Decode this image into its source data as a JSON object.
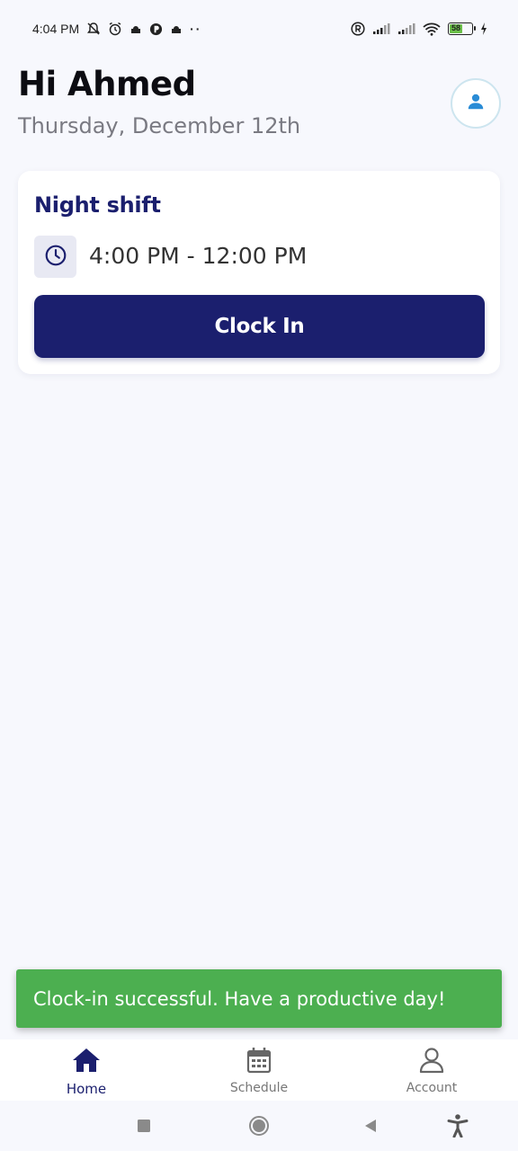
{
  "status_bar": {
    "time": "4:04 PM",
    "battery_level": "58",
    "icons": [
      "bell-off-icon",
      "alarm-icon",
      "mosque-icon",
      "app-icon",
      "mosque-icon",
      "more-dots-icon",
      "registered-icon",
      "signal-icon",
      "signal-icon",
      "wifi-icon",
      "battery-icon",
      "charging-icon"
    ],
    "more_dots": "··"
  },
  "header": {
    "greeting": "Hi Ahmed",
    "date": "Thursday, December 12th",
    "avatar_icon": "person-icon"
  },
  "shift_card": {
    "title": "Night shift",
    "clock_icon": "clock-icon",
    "time_range": "4:00 PM - 12:00 PM",
    "button_label": "Clock In"
  },
  "snackbar": {
    "message": "Clock-in successful. Have a productive day!"
  },
  "bottom_nav": {
    "items": [
      {
        "label": "Home",
        "icon": "home-icon",
        "active": true
      },
      {
        "label": "Schedule",
        "icon": "calendar-icon",
        "active": false
      },
      {
        "label": "Account",
        "icon": "person-outline-icon",
        "active": false
      }
    ]
  },
  "system_nav": {
    "buttons": [
      "recents-icon",
      "home-circle-icon",
      "back-icon",
      "accessibility-icon"
    ]
  },
  "colors": {
    "background": "#F7F8FD",
    "primary": "#1B1F6E",
    "success": "#4CAF50",
    "avatar_accent": "#2A8CD6"
  }
}
